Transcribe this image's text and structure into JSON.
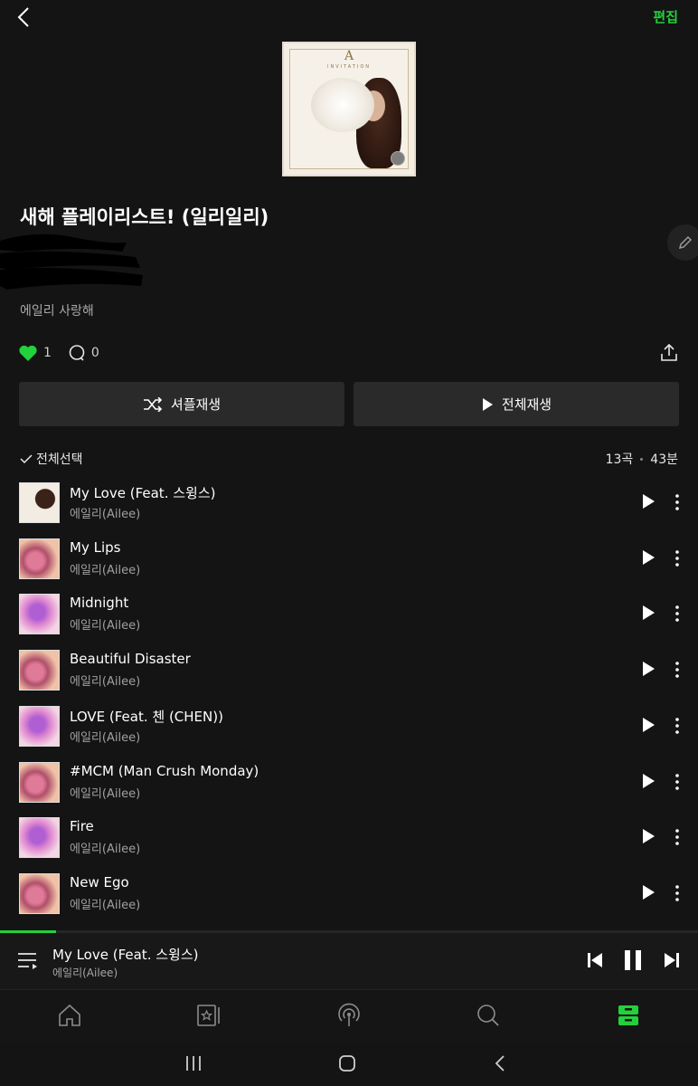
{
  "header": {
    "back_icon": "chevron-left-icon",
    "edit_label": "편집"
  },
  "playlist": {
    "title": "새해 플레이리스트! (일리일리)",
    "description": "에일리 사랑해",
    "likes": "1",
    "comments": "0",
    "cover": {
      "letter": "A",
      "subtitle": "INVITATION"
    }
  },
  "actions": {
    "shuffle_label": "셔플재생",
    "play_all_label": "전체재생"
  },
  "list_header": {
    "select_all_label": "전체선택",
    "song_count": "13곡",
    "duration": "43분"
  },
  "tracks": [
    {
      "title": "My Love (Feat. 스윙스)",
      "artist": "에일리(Ailee)",
      "thumb": "a"
    },
    {
      "title": "My Lips",
      "artist": "에일리(Ailee)",
      "thumb": "b"
    },
    {
      "title": "Midnight",
      "artist": "에일리(Ailee)",
      "thumb": "c"
    },
    {
      "title": "Beautiful Disaster",
      "artist": "에일리(Ailee)",
      "thumb": "b"
    },
    {
      "title": "LOVE (Feat. 첸 (CHEN))",
      "artist": "에일리(Ailee)",
      "thumb": "c"
    },
    {
      "title": "#MCM (Man Crush Monday)",
      "artist": "에일리(Ailee)",
      "thumb": "b"
    },
    {
      "title": "Fire",
      "artist": "에일리(Ailee)",
      "thumb": "c"
    },
    {
      "title": "New Ego",
      "artist": "에일리(Ailee)",
      "thumb": "b"
    }
  ],
  "now_playing": {
    "title": "My Love (Feat. 스윙스)",
    "artist": "에일리(Ailee)",
    "progress": 0.08
  },
  "bottom_nav": [
    "home-icon",
    "music-card-icon",
    "podcast-icon",
    "search-icon",
    "storage-icon"
  ],
  "colors": {
    "accent": "#23d13c",
    "background": "#141414",
    "button_bg": "#2a2a2a"
  }
}
